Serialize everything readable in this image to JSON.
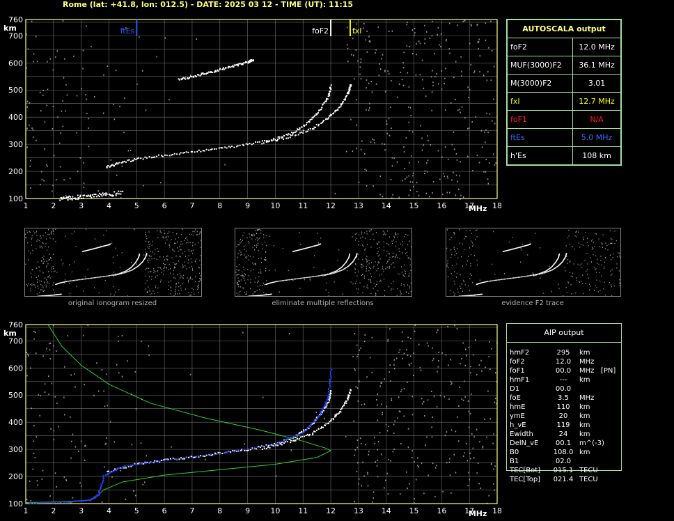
{
  "header": {
    "text": "Rome (lat: +41.8, lon: 012.5) - DATE: 2025 03 12 - TIME (UT): 11:15"
  },
  "colors": {
    "frame": "#ffff80",
    "trace": "#ffffff",
    "es_marker": "#2060ff",
    "fxI_marker": "#ffff00",
    "profile": "#30d030",
    "fit": "#2040ff",
    "table_border": "#a0e0a0",
    "foF1_color": "#ff2020",
    "ftEs_color": "#3070ff"
  },
  "autoscala": {
    "title": "AUTOSCALA output",
    "rows": [
      {
        "label": "foF2",
        "value": "12.0 MHz",
        "color": "#ffffff"
      },
      {
        "label": "MUF(3000)F2",
        "value": "36.1 MHz",
        "color": "#ffffff"
      },
      {
        "label": "M(3000)F2",
        "value": "3.01",
        "color": "#ffffff"
      },
      {
        "label": "fxI",
        "value": "12.7 MHz",
        "color": "#ffff00"
      },
      {
        "label": "foF1",
        "value": "N/A",
        "color": "#ff2020"
      },
      {
        "label": "ftEs",
        "value": "5.0 MHz",
        "color": "#3070ff"
      },
      {
        "label": "h'Es",
        "value": "108    km",
        "color": "#ffffff"
      }
    ]
  },
  "aip": {
    "title": "AIP output",
    "rows": [
      {
        "label": "hmF2",
        "value": "295",
        "unit": "km"
      },
      {
        "label": "foF2",
        "value": "12.0",
        "unit": "MHz"
      },
      {
        "label": "foF1",
        "value": "00.0",
        "unit": "MHz   [PN]"
      },
      {
        "label": "hmF1",
        "value": "---",
        "unit": "km"
      },
      {
        "label": "D1",
        "value": "00.0",
        "unit": ""
      },
      {
        "label": "foE",
        "value": "3.5",
        "unit": "MHz"
      },
      {
        "label": "hmE",
        "value": "110",
        "unit": "km"
      },
      {
        "label": "ymE",
        "value": "20",
        "unit": "km"
      },
      {
        "label": "h_vE",
        "value": "119",
        "unit": "km"
      },
      {
        "label": "Ewidth",
        "value": "24",
        "unit": "km"
      },
      {
        "label": "DelN_vE",
        "value": "00.1",
        "unit": "m^(-3)"
      },
      {
        "label": "B0",
        "value": "108.0",
        "unit": "km"
      },
      {
        "label": "B1",
        "value": "02.0",
        "unit": ""
      },
      {
        "label": "TEC[Bot]",
        "value": "015.1",
        "unit": "TECU"
      },
      {
        "label": "TEC[Top]",
        "value": "021.4",
        "unit": "TECU"
      }
    ]
  },
  "thumbnails": [
    {
      "caption": "original ionogram resized"
    },
    {
      "caption": "eliminate multiple reflections"
    },
    {
      "caption": "evidence F2 trace"
    }
  ],
  "chart_data": [
    {
      "type": "scatter",
      "xlabel": "MHz",
      "ylabel": "km",
      "xlim": [
        1,
        18
      ],
      "ylim": [
        100,
        760
      ],
      "xticks": [
        "1",
        "2",
        "3",
        "4",
        "5",
        "6",
        "7",
        "8",
        "9",
        "10",
        "11",
        "12",
        "13",
        "14",
        "15",
        "16",
        "17",
        "18"
      ],
      "yticks": [
        "100",
        "200",
        "300",
        "400",
        "500",
        "600",
        "700",
        "760"
      ],
      "grid": true,
      "markers": [
        {
          "name": "ftEs",
          "x": 5.0,
          "color": "#2060ff"
        },
        {
          "name": "foF2",
          "x": 12.0,
          "color": "#ffffff"
        },
        {
          "name": "fxI",
          "x": 12.7,
          "color": "#ffff00"
        }
      ],
      "series": [
        {
          "name": "E/Es trace",
          "points": [
            [
              2.2,
              103
            ],
            [
              2.6,
              105
            ],
            [
              3.0,
              108
            ],
            [
              3.5,
              112
            ],
            [
              4.0,
              118
            ],
            [
              4.5,
              124
            ]
          ]
        },
        {
          "name": "F2 o-trace",
          "points": [
            [
              3.9,
              218
            ],
            [
              4.3,
              232
            ],
            [
              5.0,
              248
            ],
            [
              6.0,
              262
            ],
            [
              7.0,
              275
            ],
            [
              8.0,
              288
            ],
            [
              9.0,
              302
            ],
            [
              10.0,
              322
            ],
            [
              10.7,
              350
            ],
            [
              11.2,
              385
            ],
            [
              11.6,
              430
            ],
            [
              11.9,
              480
            ],
            [
              12.0,
              520
            ]
          ]
        },
        {
          "name": "F2 x-trace",
          "points": [
            [
              9.5,
              305
            ],
            [
              10.5,
              330
            ],
            [
              11.3,
              360
            ],
            [
              11.9,
              400
            ],
            [
              12.3,
              440
            ],
            [
              12.6,
              490
            ],
            [
              12.7,
              525
            ]
          ]
        },
        {
          "name": "multiple reflection",
          "points": [
            [
              6.5,
              540
            ],
            [
              7.0,
              552
            ],
            [
              7.5,
              565
            ],
            [
              8.0,
              578
            ],
            [
              8.5,
              592
            ],
            [
              9.0,
              605
            ],
            [
              9.2,
              615
            ]
          ]
        }
      ]
    },
    {
      "type": "line",
      "xlabel": "MHz",
      "ylabel": "km",
      "xlim": [
        1,
        18
      ],
      "ylim": [
        100,
        760
      ],
      "xticks": [
        "1",
        "2",
        "3",
        "4",
        "5",
        "6",
        "7",
        "8",
        "9",
        "10",
        "11",
        "12",
        "13",
        "14",
        "15",
        "16",
        "17",
        "18"
      ],
      "yticks": [
        "100",
        "200",
        "300",
        "400",
        "500",
        "600",
        "700",
        "760"
      ],
      "grid": true,
      "series": [
        {
          "name": "trace",
          "points": [
            [
              3.9,
              218
            ],
            [
              5.0,
              248
            ],
            [
              6.0,
              262
            ],
            [
              7.0,
              275
            ],
            [
              8.0,
              288
            ],
            [
              9.0,
              302
            ],
            [
              10.0,
              322
            ],
            [
              10.7,
              350
            ],
            [
              11.2,
              385
            ],
            [
              11.6,
              430
            ],
            [
              11.9,
              480
            ],
            [
              12.0,
              520
            ]
          ]
        },
        {
          "name": "x-trace",
          "points": [
            [
              9.5,
              305
            ],
            [
              10.5,
              330
            ],
            [
              11.3,
              360
            ],
            [
              11.9,
              400
            ],
            [
              12.3,
              440
            ],
            [
              12.6,
              490
            ],
            [
              12.7,
              525
            ]
          ]
        },
        {
          "name": "fit",
          "points": [
            [
              1.1,
              104
            ],
            [
              2.5,
              108
            ],
            [
              3.3,
              115
            ],
            [
              3.6,
              135
            ],
            [
              3.8,
              205
            ],
            [
              4.5,
              240
            ],
            [
              6.0,
              262
            ],
            [
              8.0,
              288
            ],
            [
              10.0,
              322
            ],
            [
              11.0,
              365
            ],
            [
              11.6,
              430
            ],
            [
              11.9,
              500
            ],
            [
              12.0,
              600
            ]
          ]
        },
        {
          "name": "profile",
          "points": [
            [
              1.8,
              760
            ],
            [
              2.3,
              680
            ],
            [
              3.0,
              610
            ],
            [
              4.0,
              540
            ],
            [
              5.5,
              470
            ],
            [
              7.5,
              415
            ],
            [
              9.5,
              370
            ],
            [
              11.0,
              330
            ],
            [
              11.8,
              305
            ],
            [
              12.0,
              295
            ],
            [
              11.5,
              270
            ],
            [
              10.0,
              245
            ],
            [
              8.0,
              225
            ],
            [
              6.0,
              205
            ],
            [
              4.5,
              180
            ],
            [
              3.8,
              150
            ],
            [
              3.5,
              120
            ],
            [
              3.3,
              112
            ],
            [
              2.0,
              106
            ],
            [
              1.0,
              104
            ]
          ]
        }
      ]
    }
  ]
}
